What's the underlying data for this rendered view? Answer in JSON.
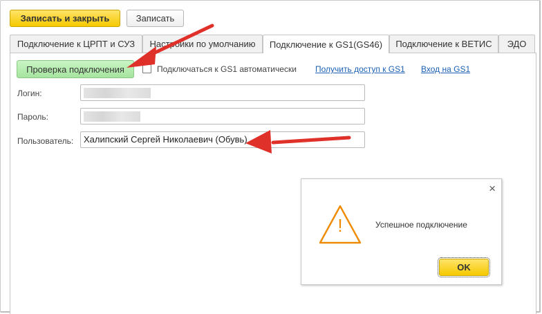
{
  "toolbar": {
    "save_close_label": "Записать и закрыть",
    "save_label": "Записать"
  },
  "tabs": [
    {
      "label": "Подключение к ЦРПТ и СУЗ",
      "active": false
    },
    {
      "label": "Настройки по умолчанию",
      "active": false
    },
    {
      "label": "Подключение к GS1(GS46)",
      "active": true
    },
    {
      "label": "Подключение к ВЕТИС",
      "active": false
    },
    {
      "label": "ЭДО",
      "active": false
    }
  ],
  "gs1": {
    "check_button_label": "Проверка подключения",
    "auto_connect_label": "Подключаться к GS1 автоматически",
    "auto_connect_checked": false,
    "get_access_link": "Получить доступ к GS1",
    "login_link": "Вход на GS1",
    "login_label": "Логин:",
    "login_value": "",
    "password_label": "Пароль:",
    "password_value": "",
    "user_label": "Пользователь:",
    "user_value": "Халипский Сергей Николаевич (Обувь)"
  },
  "dialog": {
    "message": "Успешное подключение",
    "ok_label": "OK",
    "close_glyph": "×",
    "warning_glyph": "!"
  },
  "colors": {
    "accent_yellow": "#f5c900",
    "check_button_green": "#a6e49f",
    "arrow_red": "#e0302a",
    "warning_orange": "#f08a00",
    "link_blue": "#1a5fb4"
  }
}
